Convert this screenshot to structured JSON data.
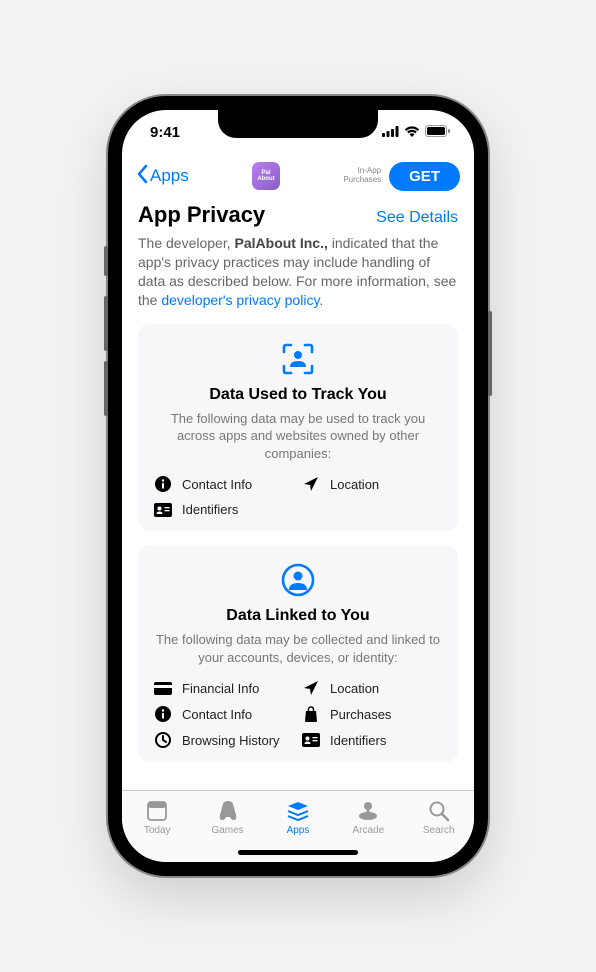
{
  "status": {
    "time": "9:41"
  },
  "nav": {
    "back_label": "Apps",
    "app_icon_text": "Pal\nAbout",
    "iap_line1": "In-App",
    "iap_line2": "Purchases",
    "get_label": "GET"
  },
  "header": {
    "title": "App Privacy",
    "see_details": "See Details"
  },
  "intro": {
    "prefix": "The developer, ",
    "developer": "PalAbout Inc.,",
    "middle": " indicated that the app's privacy practices may include handling of data as described below. For more information, see the ",
    "link_text": "developer's privacy policy",
    "suffix": "."
  },
  "cards": [
    {
      "title": "Data Used to Track You",
      "desc": "The following data may be used to track you across apps and websites owned by other companies:",
      "items": [
        {
          "icon": "info",
          "label": "Contact Info"
        },
        {
          "icon": "arrow",
          "label": "Location"
        },
        {
          "icon": "id",
          "label": "Identifiers"
        }
      ]
    },
    {
      "title": "Data Linked to You",
      "desc": "The following data may be collected and linked to your accounts, devices, or identity:",
      "items": [
        {
          "icon": "card",
          "label": "Financial Info"
        },
        {
          "icon": "arrow",
          "label": "Location"
        },
        {
          "icon": "info",
          "label": "Contact Info"
        },
        {
          "icon": "bag",
          "label": "Purchases"
        },
        {
          "icon": "clock",
          "label": "Browsing History"
        },
        {
          "icon": "id",
          "label": "Identifiers"
        }
      ]
    }
  ],
  "tabs": [
    {
      "label": "Today"
    },
    {
      "label": "Games"
    },
    {
      "label": "Apps"
    },
    {
      "label": "Arcade"
    },
    {
      "label": "Search"
    }
  ]
}
